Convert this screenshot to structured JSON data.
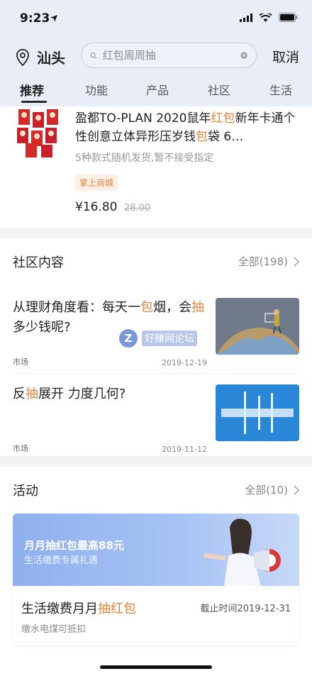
{
  "status": {
    "time": "9:23"
  },
  "header": {
    "location": "汕头",
    "search_placeholder": "红包周周抽",
    "cancel_label": "取消"
  },
  "tabs": [
    {
      "label": "推荐"
    },
    {
      "label": "功能"
    },
    {
      "label": "产品"
    },
    {
      "label": "社区"
    },
    {
      "label": "生活"
    }
  ],
  "product": {
    "title_parts": [
      "盈都TO-PLAN 2020鼠年",
      "红包",
      "新年卡通个性创意立体异形压岁钱",
      "包",
      "袋 6…"
    ],
    "subtitle": "5种款式随机发货,暂不接受指定",
    "tag": "掌上商城",
    "price": "¥16.80",
    "price_old": "28.00"
  },
  "community": {
    "title": "社区内容",
    "more": "全部(198)",
    "posts": [
      {
        "title_parts": [
          "从理财角度看：每天一",
          "包",
          "烟，会",
          "抽",
          "多少钱呢?"
        ],
        "category": "市场",
        "date": "2019-12-19"
      },
      {
        "title_parts": [
          "反",
          "抽",
          "展开 力度几何?"
        ],
        "category": "市场",
        "date": "2019-11-12"
      }
    ]
  },
  "watermark": {
    "logo": "Z",
    "text": "好赚网论坛"
  },
  "activity": {
    "title": "活动",
    "more": "全部(10)",
    "banner_title": "月月抽红包最高88元",
    "banner_sub": "生活缴费专属礼遇",
    "card_title_parts": [
      "生活缴费月月",
      "抽红包"
    ],
    "deadline": "截止时间2019-12-31",
    "card_sub": "缴水电煤可抵扣"
  },
  "colors": {
    "accent": "#e8823a",
    "header_bg": "#e9edf7"
  }
}
